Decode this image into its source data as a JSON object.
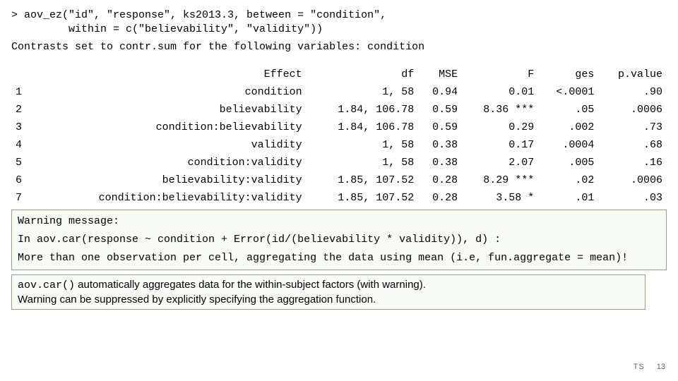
{
  "code": {
    "line1": "> aov_ez(\"id\", \"response\", ks2013.3, between = \"condition\",",
    "line2": "         within = c(\"believability\", \"validity\"))"
  },
  "contrast_line": "Contrasts set to contr.sum for the following variables: condition",
  "table": {
    "headers": [
      "",
      "Effect",
      "df",
      "MSE",
      "F",
      "ges",
      "p.value"
    ],
    "rows": [
      [
        "1",
        "condition",
        "1, 58",
        "0.94",
        "0.01",
        "<.0001",
        ".90"
      ],
      [
        "2",
        "believability",
        "1.84, 106.78",
        "0.59",
        "8.36 ***",
        ".05",
        ".0006"
      ],
      [
        "3",
        "condition:believability",
        "1.84, 106.78",
        "0.59",
        "0.29",
        ".002",
        ".73"
      ],
      [
        "4",
        "validity",
        "1, 58",
        "0.38",
        "0.17",
        ".0004",
        ".68"
      ],
      [
        "5",
        "condition:validity",
        "1, 58",
        "0.38",
        "2.07",
        ".005",
        ".16"
      ],
      [
        "6",
        "believability:validity",
        "1.85, 107.52",
        "0.28",
        "8.29 ***",
        ".02",
        ".0006"
      ],
      [
        "7",
        "condition:believability:validity",
        "1.85, 107.52",
        "0.28",
        "3.58 *",
        ".01",
        ".03"
      ]
    ]
  },
  "warning": {
    "l1": "Warning message:",
    "l2": "In aov.car(response ~ condition + Error(id/(believability * validity)), d) :",
    "l3": "  More than one observation per cell, aggregating the data using mean (i.e, fun.aggregate = mean)!"
  },
  "note": {
    "mono": "aov.car()",
    "tail1": " automatically aggregates data for the within-subject factors (with warning).",
    "line2": "Warning can be suppressed by explicitly specifying the aggregation function."
  },
  "footer": {
    "ts": "TS",
    "page": "13"
  }
}
